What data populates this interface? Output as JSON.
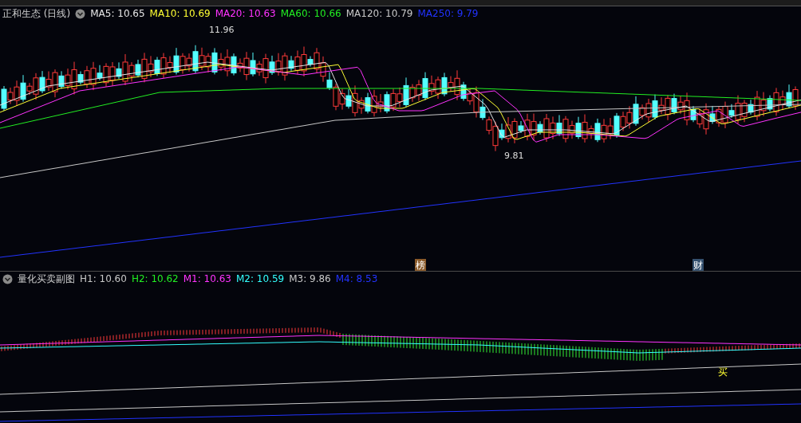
{
  "stock": {
    "name": "正和生态",
    "period": "(日线)"
  },
  "ma_legend": [
    {
      "label": "MA5: 10.65",
      "color": "#e6e6e6"
    },
    {
      "label": "MA10: 10.69",
      "color": "#ffff33"
    },
    {
      "label": "MA20: 10.63",
      "color": "#ff33ff"
    },
    {
      "label": "MA60: 10.66",
      "color": "#22ee22"
    },
    {
      "label": "MA120: 10.79",
      "color": "#c8c8c8"
    },
    {
      "label": "MA250: 9.79",
      "color": "#2233ff"
    }
  ],
  "price_labels": [
    {
      "kind": "high",
      "label": "11.96"
    },
    {
      "kind": "low",
      "label": "9.81"
    }
  ],
  "events": [
    {
      "label": "榜",
      "color": "#8a5a2a"
    },
    {
      "label": "财",
      "color": "#34506e"
    }
  ],
  "sub_chart": {
    "title": "量化买卖副图",
    "legend": [
      {
        "label": "H1: 10.60",
        "color": "#c8c8c8"
      },
      {
        "label": "H2: 10.62",
        "color": "#22ee22"
      },
      {
        "label": "M1: 10.63",
        "color": "#ff33ff"
      },
      {
        "label": "M2: 10.59",
        "color": "#33ffff"
      },
      {
        "label": "M3: 9.86",
        "color": "#c8c8c8"
      },
      {
        "label": "M4: 8.53",
        "color": "#2233ff"
      }
    ],
    "signal": "买"
  }
}
